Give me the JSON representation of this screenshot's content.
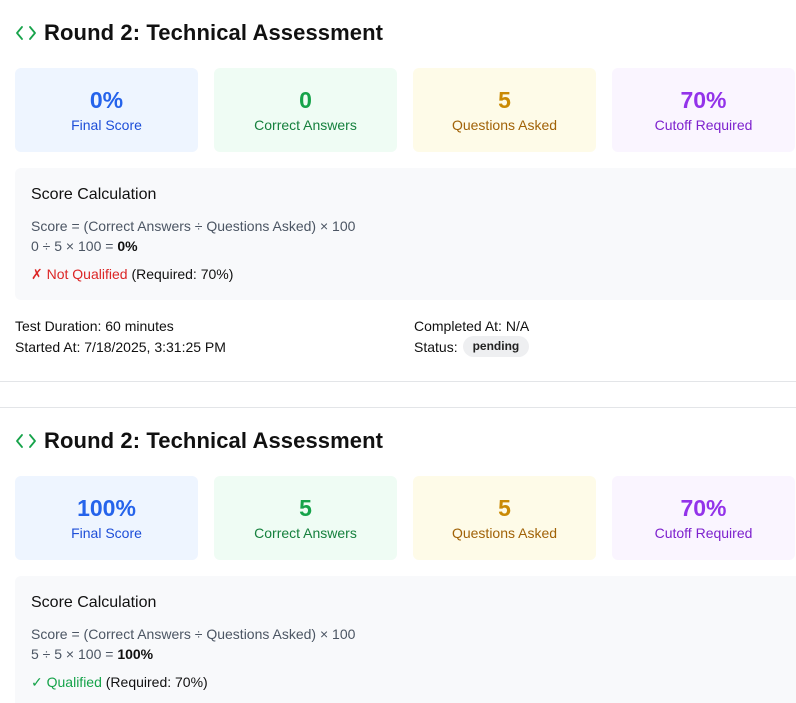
{
  "rounds": [
    {
      "title": "Round 2: Technical Assessment",
      "cards": {
        "final_score": {
          "value": "0%",
          "label": "Final Score"
        },
        "correct_answers": {
          "value": "0",
          "label": "Correct Answers"
        },
        "questions_asked": {
          "value": "5",
          "label": "Questions Asked"
        },
        "cutoff_required": {
          "value": "70%",
          "label": "Cutoff Required"
        }
      },
      "calculation": {
        "title": "Score Calculation",
        "formula": "Score = (Correct Answers ÷ Questions Asked) × 100",
        "expression": "0 ÷ 5 × 100 = ",
        "result": "0%",
        "status_mark": "✗ Not Qualified",
        "status_note": " (Required: 70%)"
      },
      "meta": {
        "duration": "Test Duration: 60 minutes",
        "started": "Started At: 7/18/2025, 3:31:25 PM",
        "completed": "Completed At: N/A",
        "status_label": "Status:",
        "status_badge": "pending"
      }
    },
    {
      "title": "Round 2: Technical Assessment",
      "cards": {
        "final_score": {
          "value": "100%",
          "label": "Final Score"
        },
        "correct_answers": {
          "value": "5",
          "label": "Correct Answers"
        },
        "questions_asked": {
          "value": "5",
          "label": "Questions Asked"
        },
        "cutoff_required": {
          "value": "70%",
          "label": "Cutoff Required"
        }
      },
      "calculation": {
        "title": "Score Calculation",
        "formula": "Score = (Correct Answers ÷ Questions Asked) × 100",
        "expression": "5 ÷ 5 × 100 = ",
        "result": "100%",
        "status_mark": "✓ Qualified",
        "status_note": " (Required: 70%)"
      }
    }
  ],
  "colors": {
    "icon_green": "#16a34a",
    "fail_red": "#dc2626",
    "pass_green": "#16a34a"
  },
  "icons": {
    "round_icon": "code-icon"
  }
}
